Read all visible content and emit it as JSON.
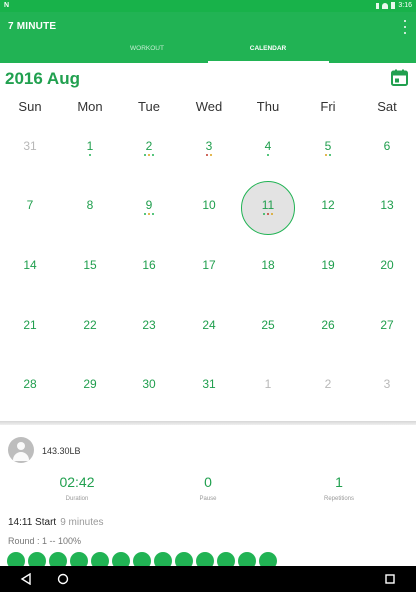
{
  "status_bar": {
    "left_label": "N",
    "time": "3:16"
  },
  "app": {
    "title": "7 MINUTE"
  },
  "tabs": [
    {
      "label": "WORKOUT"
    },
    {
      "label": "CALENDAR"
    }
  ],
  "month_title": "2016 Aug",
  "weekdays": [
    "Sun",
    "Mon",
    "Tue",
    "Wed",
    "Thu",
    "Fri",
    "Sat"
  ],
  "weeks": [
    [
      "31",
      "1",
      "2",
      "3",
      "4",
      "5",
      "6"
    ],
    [
      "7",
      "8",
      "9",
      "10",
      "11",
      "12",
      "13"
    ],
    [
      "14",
      "15",
      "16",
      "17",
      "18",
      "19",
      "20"
    ],
    [
      "21",
      "22",
      "23",
      "24",
      "25",
      "26",
      "27"
    ],
    [
      "28",
      "29",
      "30",
      "31",
      "1",
      "2",
      "3"
    ]
  ],
  "today": "11",
  "stats": {
    "weight": "143.30LB",
    "duration": {
      "value": "02:42",
      "label": "Duration"
    },
    "pause": {
      "value": "0",
      "label": "Pause"
    },
    "repetitions": {
      "value": "1",
      "label": "Repetitions"
    },
    "start": "14:11 Start",
    "length": "9 minutes",
    "round": "Round : 1 -- 100%"
  },
  "colors": {
    "accent": "#21b354",
    "dark_green": "#21a04f",
    "dot_red": "#c0392b",
    "dot_gold": "#d9a21b"
  }
}
